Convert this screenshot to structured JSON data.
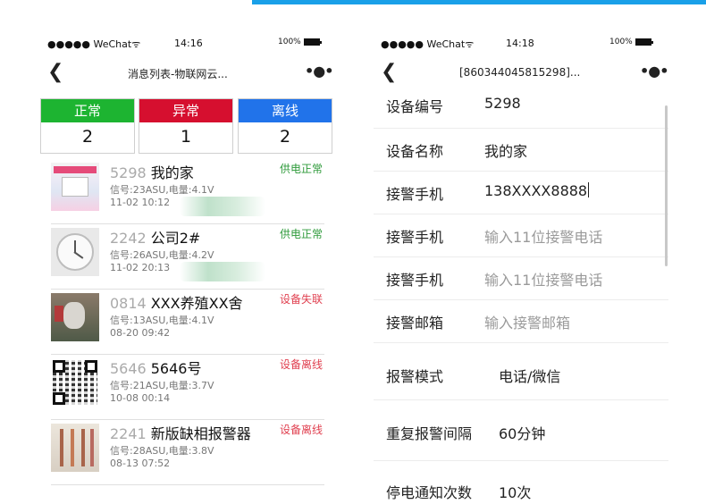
{
  "left": {
    "statusbar": {
      "carrier": "●●●●● WeChat",
      "wifi": "ᯤ",
      "time": "14:16",
      "battery": "100%"
    },
    "nav": {
      "back": "❮",
      "title": "消息列表-物联网云...",
      "more": "•●•"
    },
    "tabs": [
      {
        "label": "正常",
        "count": "2",
        "color": "#1db431"
      },
      {
        "label": "异常",
        "count": "1",
        "color": "#d60f2f"
      },
      {
        "label": "离线",
        "count": "2",
        "color": "#2173ea"
      }
    ],
    "devices": [
      {
        "num": "5298",
        "name": "我的家",
        "status": "供电正常",
        "status_color": "#2e9a3a",
        "signal": "信号:23ASU,电量:4.1V",
        "time": "11-02 10:12"
      },
      {
        "num": "2242",
        "name": "公司2#",
        "status": "供电正常",
        "status_color": "#2e9a3a",
        "signal": "信号:26ASU,电量:4.2V",
        "time": "11-02 20:13"
      },
      {
        "num": "0814",
        "name": "XXX养殖XX舍",
        "status": "设备失联",
        "status_color": "#e04050",
        "signal": "信号:13ASU,电量:4.1V",
        "time": "08-20 09:42"
      },
      {
        "num": "5646",
        "name": "5646号",
        "status": "设备离线",
        "status_color": "#e04050",
        "signal": "信号:21ASU,电量:3.7V",
        "time": "10-08 00:14"
      },
      {
        "num": "2241",
        "name": "新版缺相报警器",
        "status": "设备离线",
        "status_color": "#e04050",
        "signal": "信号:28ASU,电量:3.8V",
        "time": "08-13 07:52"
      }
    ]
  },
  "right": {
    "statusbar": {
      "carrier": "●●●●● WeChat",
      "wifi": "ᯤ",
      "time": "14:18",
      "battery": "100%"
    },
    "nav": {
      "back": "❮",
      "title": "[860344045815298]...",
      "more": "•●•"
    },
    "form": {
      "device_id_label": "设备编号",
      "device_id_value": "5298",
      "device_name_label": "设备名称",
      "device_name_value": "我的家",
      "phone1_label": "接警手机",
      "phone1_value": "138XXXX8888",
      "phone2_label": "接警手机",
      "phone2_placeholder": "输入11位接警电话",
      "phone3_label": "接警手机",
      "phone3_placeholder": "输入11位接警电话",
      "email_label": "接警邮箱",
      "email_placeholder": "输入接警邮箱",
      "mode_label": "报警模式",
      "mode_value": "电话/微信",
      "repeat_label": "重复报警间隔",
      "repeat_value": "60分钟",
      "notify_label": "停电通知次数",
      "notify_value": "10次"
    }
  }
}
